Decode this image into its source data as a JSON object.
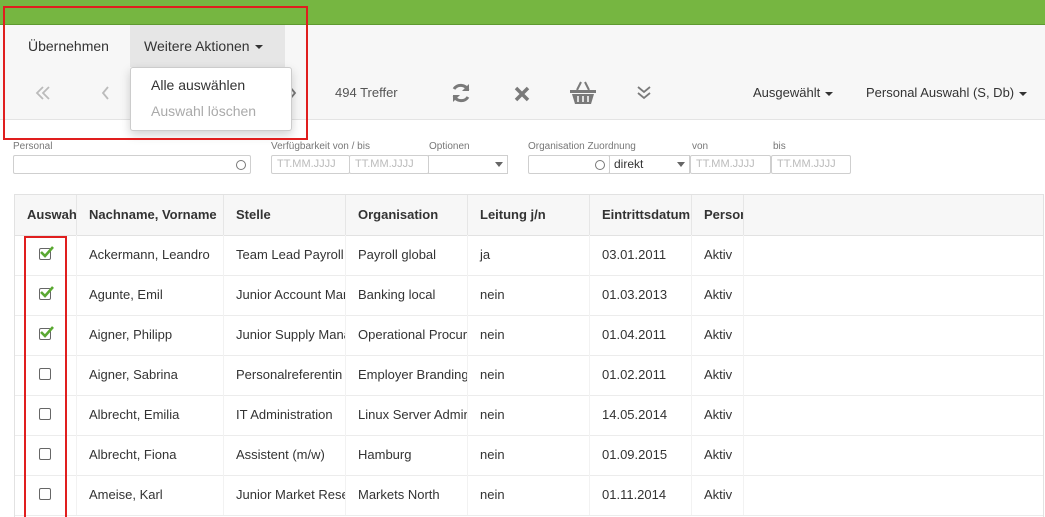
{
  "menubar": {
    "uebernehmen": "Übernehmen",
    "weitere_aktionen": "Weitere Aktionen"
  },
  "dropdown": {
    "items": [
      {
        "label": "Alle auswählen",
        "enabled": true
      },
      {
        "label": "Auswahl löschen",
        "enabled": false
      }
    ]
  },
  "toolbar": {
    "hits": "494 Treffer",
    "selected": "Ausgewählt",
    "personal_selection": "Personal Auswahl (S, Db)",
    "icons": [
      "first-page-icon",
      "prev-page-icon",
      "next-page-icon",
      "refresh-icon",
      "close-icon",
      "basket-icon",
      "expand-down-icon"
    ]
  },
  "filters": {
    "personal_label": "Personal",
    "availability_label": "Verfügbarkeit von / bis",
    "date_placeholder": "TT.MM.JJJJ",
    "options_label": "Optionen",
    "org_label": "Organisation Zuordnung",
    "direkt": "direkt",
    "von_label": "von",
    "bis_label": "bis"
  },
  "table": {
    "headers": [
      "Auswahl",
      "Nachname, Vorname",
      "Stelle",
      "Organisation",
      "Leitung j/n",
      "Eintrittsdatum",
      "Personalstatus"
    ],
    "rows": [
      {
        "checked": true,
        "name": "Ackermann, Leandro",
        "stelle": "Team Lead Payroll",
        "org": "Payroll global",
        "leitung": "ja",
        "eintritt": "03.01.2011",
        "status": "Aktiv"
      },
      {
        "checked": true,
        "name": "Agunte, Emil",
        "stelle": "Junior Account Manager",
        "org": "Banking local",
        "leitung": "nein",
        "eintritt": "01.03.2013",
        "status": "Aktiv"
      },
      {
        "checked": true,
        "name": "Aigner, Philipp",
        "stelle": "Junior Supply Manager",
        "org": "Operational Procurement",
        "leitung": "nein",
        "eintritt": "01.04.2011",
        "status": "Aktiv"
      },
      {
        "checked": false,
        "name": "Aigner, Sabrina",
        "stelle": "Personalreferentin",
        "org": "Employer Branding",
        "leitung": "nein",
        "eintritt": "01.02.2011",
        "status": "Aktiv"
      },
      {
        "checked": false,
        "name": "Albrecht, Emilia",
        "stelle": "IT Administration",
        "org": "Linux Server Administration",
        "leitung": "nein",
        "eintritt": "14.05.2014",
        "status": "Aktiv"
      },
      {
        "checked": false,
        "name": "Albrecht, Fiona",
        "stelle": "Assistent (m/w)",
        "org": "Hamburg",
        "leitung": "nein",
        "eintritt": "01.09.2015",
        "status": "Aktiv"
      },
      {
        "checked": false,
        "name": "Ameise, Karl",
        "stelle": "Junior Market Research",
        "org": "Markets North",
        "leitung": "nein",
        "eintritt": "01.11.2014",
        "status": "Aktiv"
      }
    ]
  },
  "colors": {
    "topbar": "#76b641",
    "check": "#5aa832",
    "highlight": "#e01e1e"
  }
}
